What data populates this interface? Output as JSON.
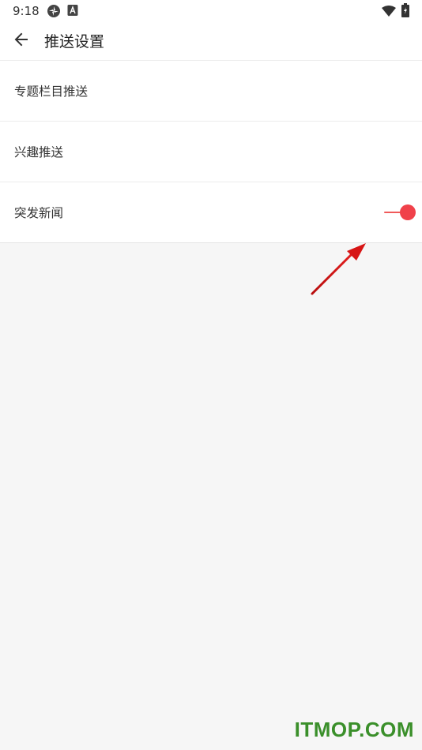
{
  "status_bar": {
    "time": "9:18",
    "icons": [
      "settings-flower-icon",
      "text-a-icon",
      "wifi-icon",
      "battery-charging-icon"
    ]
  },
  "toolbar": {
    "back_icon": "arrow-left-icon",
    "title": "推送设置"
  },
  "settings": {
    "items": [
      {
        "label": "专题栏目推送"
      },
      {
        "label": "兴趣推送"
      },
      {
        "label": "突发新闻",
        "toggle": "on"
      }
    ]
  },
  "colors": {
    "accent": "#f0414a",
    "background": "#f6f6f6",
    "surface": "#ffffff",
    "divider": "#ececec"
  },
  "watermark": "ITMOP.COM"
}
